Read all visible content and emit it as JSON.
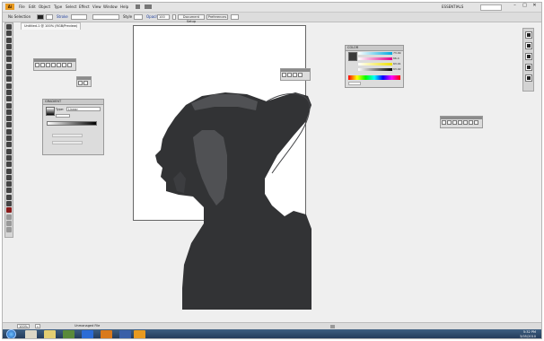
{
  "app": {
    "logo": "Ai",
    "menus": [
      "File",
      "Edit",
      "Object",
      "Type",
      "Select",
      "Effect",
      "View",
      "Window",
      "Help"
    ],
    "workspace": "ESSENTIALS",
    "window_controls": [
      "–",
      "□",
      "✕"
    ]
  },
  "control_bar": {
    "selection_label": "No Selection",
    "stroke_label": "Stroke",
    "style_label": "Style",
    "opacity_label": "Opacity",
    "opacity_value": "100",
    "document_setup": "Document Setup",
    "preferences": "Preferences"
  },
  "document": {
    "tab_label": "Untitled-1 @ 100% (RGB/Preview)"
  },
  "palettes": {
    "gradient": {
      "title": "GRADIENT",
      "type_label": "Type:",
      "type_value": "Linear"
    },
    "color": {
      "title": "COLOR",
      "values": [
        "73.09",
        "66.4",
        "63.91",
        "63.92"
      ]
    }
  },
  "status_bar": {
    "zoom": "100%",
    "page": "1",
    "status_text": "Unmanaged File"
  },
  "taskbar": {
    "time": "5:32 PM",
    "date": "3/05/2010"
  },
  "colors": {
    "silhouette": "#323335",
    "hair_highlight": "#505154",
    "ai_orange": "#e89a20"
  }
}
